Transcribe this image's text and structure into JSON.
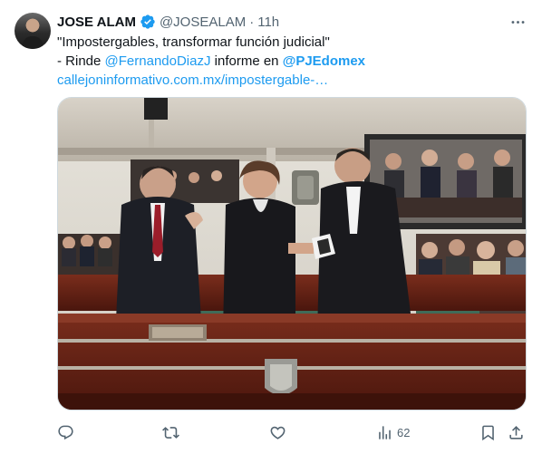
{
  "tweet": {
    "author_name": "JOSE ALAM",
    "handle": "@JOSEALAM",
    "separator": "·",
    "time": "11h",
    "line1": "\"Impostergables, transformar función judicial\"",
    "line2_prefix": "- Rinde ",
    "mention1": "@FernandoDiazJ",
    "line2_middle": " informe en ",
    "mention2": "@PJEdomex",
    "url": "callejoninformativo.com.mx/impostergable-…"
  },
  "actions": {
    "views_count": "62"
  },
  "icons": {
    "verified": "verified-badge-icon",
    "more": "more-icon",
    "reply": "reply-icon",
    "retweet": "retweet-icon",
    "like": "like-icon",
    "views": "views-icon",
    "bookmark": "bookmark-icon",
    "share": "share-icon"
  },
  "colors": {
    "accent": "#1d9bf0",
    "secondary_text": "#536471",
    "primary_text": "#0f1419"
  }
}
